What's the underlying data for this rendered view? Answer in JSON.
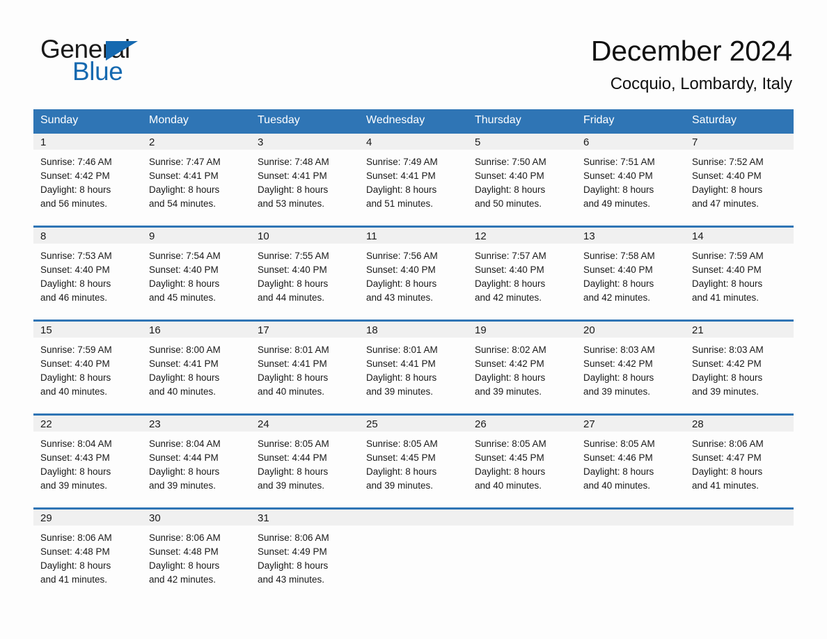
{
  "brand": {
    "name_part1": "General",
    "name_part2": "Blue",
    "accent_color": "#1569b0"
  },
  "header": {
    "title": "December 2024",
    "subtitle": "Cocquio, Lombardy, Italy"
  },
  "calendar": {
    "header_color": "#2f75b5",
    "weekday_headers": [
      "Sunday",
      "Monday",
      "Tuesday",
      "Wednesday",
      "Thursday",
      "Friday",
      "Saturday"
    ],
    "weeks": [
      [
        {
          "day": "1",
          "sunrise": "Sunrise: 7:46 AM",
          "sunset": "Sunset: 4:42 PM",
          "daylight_line1": "Daylight: 8 hours",
          "daylight_line2": "and 56 minutes."
        },
        {
          "day": "2",
          "sunrise": "Sunrise: 7:47 AM",
          "sunset": "Sunset: 4:41 PM",
          "daylight_line1": "Daylight: 8 hours",
          "daylight_line2": "and 54 minutes."
        },
        {
          "day": "3",
          "sunrise": "Sunrise: 7:48 AM",
          "sunset": "Sunset: 4:41 PM",
          "daylight_line1": "Daylight: 8 hours",
          "daylight_line2": "and 53 minutes."
        },
        {
          "day": "4",
          "sunrise": "Sunrise: 7:49 AM",
          "sunset": "Sunset: 4:41 PM",
          "daylight_line1": "Daylight: 8 hours",
          "daylight_line2": "and 51 minutes."
        },
        {
          "day": "5",
          "sunrise": "Sunrise: 7:50 AM",
          "sunset": "Sunset: 4:40 PM",
          "daylight_line1": "Daylight: 8 hours",
          "daylight_line2": "and 50 minutes."
        },
        {
          "day": "6",
          "sunrise": "Sunrise: 7:51 AM",
          "sunset": "Sunset: 4:40 PM",
          "daylight_line1": "Daylight: 8 hours",
          "daylight_line2": "and 49 minutes."
        },
        {
          "day": "7",
          "sunrise": "Sunrise: 7:52 AM",
          "sunset": "Sunset: 4:40 PM",
          "daylight_line1": "Daylight: 8 hours",
          "daylight_line2": "and 47 minutes."
        }
      ],
      [
        {
          "day": "8",
          "sunrise": "Sunrise: 7:53 AM",
          "sunset": "Sunset: 4:40 PM",
          "daylight_line1": "Daylight: 8 hours",
          "daylight_line2": "and 46 minutes."
        },
        {
          "day": "9",
          "sunrise": "Sunrise: 7:54 AM",
          "sunset": "Sunset: 4:40 PM",
          "daylight_line1": "Daylight: 8 hours",
          "daylight_line2": "and 45 minutes."
        },
        {
          "day": "10",
          "sunrise": "Sunrise: 7:55 AM",
          "sunset": "Sunset: 4:40 PM",
          "daylight_line1": "Daylight: 8 hours",
          "daylight_line2": "and 44 minutes."
        },
        {
          "day": "11",
          "sunrise": "Sunrise: 7:56 AM",
          "sunset": "Sunset: 4:40 PM",
          "daylight_line1": "Daylight: 8 hours",
          "daylight_line2": "and 43 minutes."
        },
        {
          "day": "12",
          "sunrise": "Sunrise: 7:57 AM",
          "sunset": "Sunset: 4:40 PM",
          "daylight_line1": "Daylight: 8 hours",
          "daylight_line2": "and 42 minutes."
        },
        {
          "day": "13",
          "sunrise": "Sunrise: 7:58 AM",
          "sunset": "Sunset: 4:40 PM",
          "daylight_line1": "Daylight: 8 hours",
          "daylight_line2": "and 42 minutes."
        },
        {
          "day": "14",
          "sunrise": "Sunrise: 7:59 AM",
          "sunset": "Sunset: 4:40 PM",
          "daylight_line1": "Daylight: 8 hours",
          "daylight_line2": "and 41 minutes."
        }
      ],
      [
        {
          "day": "15",
          "sunrise": "Sunrise: 7:59 AM",
          "sunset": "Sunset: 4:40 PM",
          "daylight_line1": "Daylight: 8 hours",
          "daylight_line2": "and 40 minutes."
        },
        {
          "day": "16",
          "sunrise": "Sunrise: 8:00 AM",
          "sunset": "Sunset: 4:41 PM",
          "daylight_line1": "Daylight: 8 hours",
          "daylight_line2": "and 40 minutes."
        },
        {
          "day": "17",
          "sunrise": "Sunrise: 8:01 AM",
          "sunset": "Sunset: 4:41 PM",
          "daylight_line1": "Daylight: 8 hours",
          "daylight_line2": "and 40 minutes."
        },
        {
          "day": "18",
          "sunrise": "Sunrise: 8:01 AM",
          "sunset": "Sunset: 4:41 PM",
          "daylight_line1": "Daylight: 8 hours",
          "daylight_line2": "and 39 minutes."
        },
        {
          "day": "19",
          "sunrise": "Sunrise: 8:02 AM",
          "sunset": "Sunset: 4:42 PM",
          "daylight_line1": "Daylight: 8 hours",
          "daylight_line2": "and 39 minutes."
        },
        {
          "day": "20",
          "sunrise": "Sunrise: 8:03 AM",
          "sunset": "Sunset: 4:42 PM",
          "daylight_line1": "Daylight: 8 hours",
          "daylight_line2": "and 39 minutes."
        },
        {
          "day": "21",
          "sunrise": "Sunrise: 8:03 AM",
          "sunset": "Sunset: 4:42 PM",
          "daylight_line1": "Daylight: 8 hours",
          "daylight_line2": "and 39 minutes."
        }
      ],
      [
        {
          "day": "22",
          "sunrise": "Sunrise: 8:04 AM",
          "sunset": "Sunset: 4:43 PM",
          "daylight_line1": "Daylight: 8 hours",
          "daylight_line2": "and 39 minutes."
        },
        {
          "day": "23",
          "sunrise": "Sunrise: 8:04 AM",
          "sunset": "Sunset: 4:44 PM",
          "daylight_line1": "Daylight: 8 hours",
          "daylight_line2": "and 39 minutes."
        },
        {
          "day": "24",
          "sunrise": "Sunrise: 8:05 AM",
          "sunset": "Sunset: 4:44 PM",
          "daylight_line1": "Daylight: 8 hours",
          "daylight_line2": "and 39 minutes."
        },
        {
          "day": "25",
          "sunrise": "Sunrise: 8:05 AM",
          "sunset": "Sunset: 4:45 PM",
          "daylight_line1": "Daylight: 8 hours",
          "daylight_line2": "and 39 minutes."
        },
        {
          "day": "26",
          "sunrise": "Sunrise: 8:05 AM",
          "sunset": "Sunset: 4:45 PM",
          "daylight_line1": "Daylight: 8 hours",
          "daylight_line2": "and 40 minutes."
        },
        {
          "day": "27",
          "sunrise": "Sunrise: 8:05 AM",
          "sunset": "Sunset: 4:46 PM",
          "daylight_line1": "Daylight: 8 hours",
          "daylight_line2": "and 40 minutes."
        },
        {
          "day": "28",
          "sunrise": "Sunrise: 8:06 AM",
          "sunset": "Sunset: 4:47 PM",
          "daylight_line1": "Daylight: 8 hours",
          "daylight_line2": "and 41 minutes."
        }
      ],
      [
        {
          "day": "29",
          "sunrise": "Sunrise: 8:06 AM",
          "sunset": "Sunset: 4:48 PM",
          "daylight_line1": "Daylight: 8 hours",
          "daylight_line2": "and 41 minutes."
        },
        {
          "day": "30",
          "sunrise": "Sunrise: 8:06 AM",
          "sunset": "Sunset: 4:48 PM",
          "daylight_line1": "Daylight: 8 hours",
          "daylight_line2": "and 42 minutes."
        },
        {
          "day": "31",
          "sunrise": "Sunrise: 8:06 AM",
          "sunset": "Sunset: 4:49 PM",
          "daylight_line1": "Daylight: 8 hours",
          "daylight_line2": "and 43 minutes."
        },
        {
          "day": "",
          "sunrise": "",
          "sunset": "",
          "daylight_line1": "",
          "daylight_line2": ""
        },
        {
          "day": "",
          "sunrise": "",
          "sunset": "",
          "daylight_line1": "",
          "daylight_line2": ""
        },
        {
          "day": "",
          "sunrise": "",
          "sunset": "",
          "daylight_line1": "",
          "daylight_line2": ""
        },
        {
          "day": "",
          "sunrise": "",
          "sunset": "",
          "daylight_line1": "",
          "daylight_line2": ""
        }
      ]
    ]
  }
}
